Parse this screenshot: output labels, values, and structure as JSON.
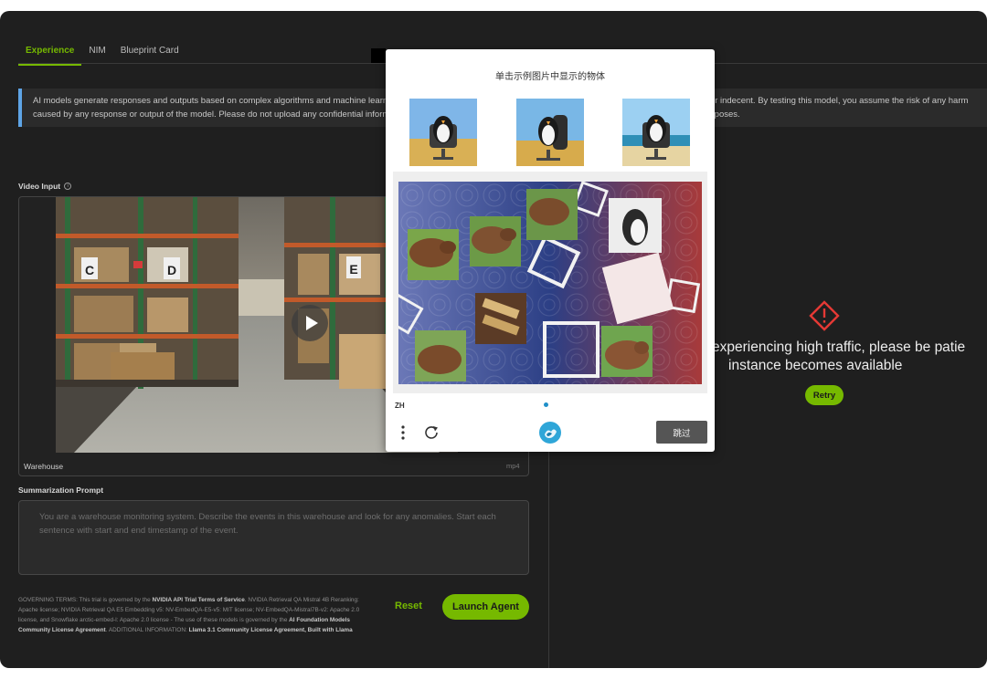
{
  "tabs": [
    {
      "label": "Experience",
      "active": true
    },
    {
      "label": "NIM",
      "active": false
    },
    {
      "label": "Blueprint Card",
      "active": false
    }
  ],
  "notice": {
    "line1": "AI models generate responses and outputs based on complex algorithms and machine learning techniques, and those responses or outputs may be inaccurate, harmful, biased or indecent. By testing this model, you assume the risk of any harm",
    "line2": "caused by any response or output of the model. Please do not upload any confidential information or personal data unless expressly permitted. Your use is logged for security purposes."
  },
  "video_input": {
    "label": "Video Input",
    "file_name": "Warehouse",
    "file_ext": "mp4",
    "shelf_labels": [
      "C",
      "D",
      "E"
    ]
  },
  "summarization": {
    "label": "Summarization Prompt",
    "placeholder": "You are a warehouse monitoring system. Describe the events in this warehouse and look for any anomalies. Start each sentence with start and end timestamp of the event."
  },
  "terms": {
    "p1": "GOVERNING TERMS: This trial is governed by the ",
    "l1": "NVIDIA API Trial Terms of Service",
    "p2": ". NVIDIA Retrieval QA Mistral 4B Reranking: Apache license; NVIDIA Retrieval QA E5 Embedding v5: NV-EmbedQA-E5-v5: MIT license; NV-EmbedQA-Mistral7B-v2: Apache 2.0 license, and Snowflake arctic-embed-l: Apache 2.0 license - The use of these models is governed by the ",
    "l2": "AI Foundation Models Community License Agreement",
    "p3": ". ADDITIONAL INFORMATION: ",
    "l3": "Llama 3.1 Community License Agreement, Built with Llama"
  },
  "actions": {
    "reset": "Reset",
    "launch": "Launch Agent"
  },
  "error": {
    "line1": "experiencing high traffic, please be patie",
    "line2": "instance becomes available",
    "retry": "Retry"
  },
  "captcha": {
    "title": "单击示例图片中显示的物体",
    "language": "ZH",
    "skip": "跳过"
  },
  "colors": {
    "accent": "#76b900",
    "info": "#5ea4e6",
    "warning": "#e53935"
  }
}
